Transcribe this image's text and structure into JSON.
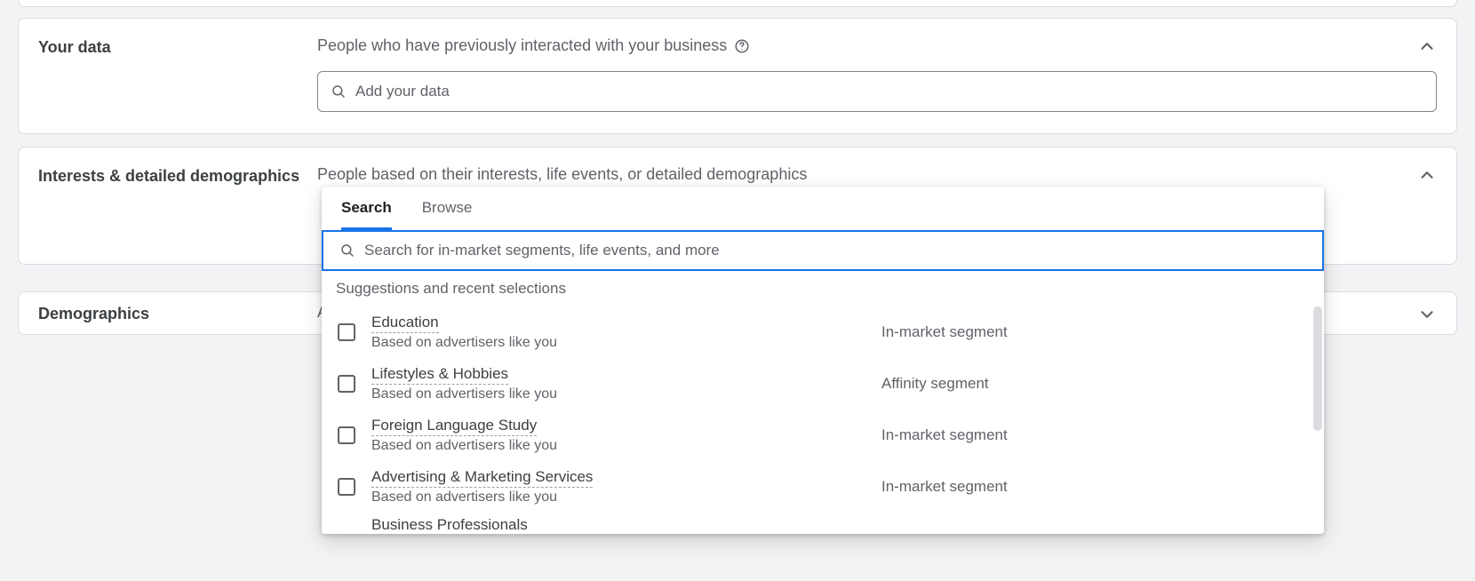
{
  "your_data": {
    "label": "Your data",
    "description": "People who have previously interacted with your business",
    "input_placeholder": "Add your data"
  },
  "interests": {
    "label": "Interests & detailed demographics",
    "description": "People based on their interests, life events, or detailed demographics",
    "tabs": {
      "search": "Search",
      "browse": "Browse"
    },
    "search_placeholder": "Search for in-market segments, life events, and more",
    "suggestions_header": "Suggestions and recent selections",
    "suggestions": [
      {
        "title": "Education",
        "sub": "Based on advertisers like you",
        "type": "In-market segment"
      },
      {
        "title": "Lifestyles & Hobbies",
        "sub": "Based on advertisers like you",
        "type": "Affinity segment"
      },
      {
        "title": "Foreign Language Study",
        "sub": "Based on advertisers like you",
        "type": "In-market segment"
      },
      {
        "title": "Advertising & Marketing Services",
        "sub": "Based on advertisers like you",
        "type": "In-market segment"
      }
    ],
    "partial_next": "Business Professionals"
  },
  "demographics": {
    "label": "Demographics",
    "desc_first_char": "A"
  }
}
